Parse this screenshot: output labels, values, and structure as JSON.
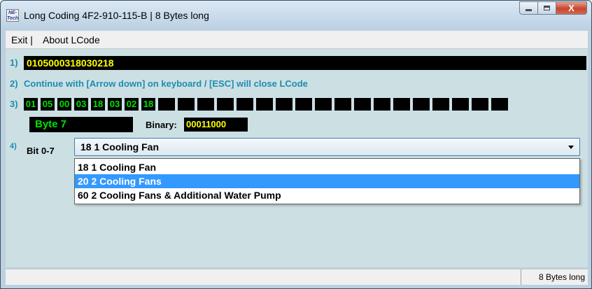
{
  "window": {
    "title": "Long Coding  4F2-910-115-B | 8 Bytes long",
    "icon_text": "NE-Tech",
    "close_glyph": "X"
  },
  "menu": {
    "items": [
      "Exit |",
      "About LCode"
    ]
  },
  "section1": {
    "label": "1)",
    "coding": "0105000318030218"
  },
  "section2": {
    "label": "2)",
    "instruction": "Continue with [Arrow down] on keyboard / [ESC] will close LCode"
  },
  "section3": {
    "label": "3)",
    "bytes": [
      "01",
      "05",
      "00",
      "03",
      "18",
      "03",
      "02",
      "18",
      "",
      "",
      "",
      "",
      "",
      "",
      "",
      "",
      "",
      "",
      "",
      "",
      "",
      "",
      "",
      "",
      "",
      ""
    ],
    "selected_byte_label": "Byte 7",
    "binary_label": "Binary:",
    "binary_value": "00011000"
  },
  "section4": {
    "label": "4)",
    "bit_label": "Bit 0-7",
    "combo_value": "18 1 Cooling Fan",
    "options": [
      "18 1 Cooling Fan",
      "20 2 Cooling Fans",
      "60 2 Cooling Fans & Additional Water Pump"
    ],
    "highlighted_index": 1
  },
  "statusbar": {
    "text": "8 Bytes long"
  },
  "colors": {
    "client_bg": "#cce0e4",
    "label_blue": "#1e8cb0",
    "byte_green": "#00e000",
    "code_yellow": "#ffff00",
    "selection_blue": "#3399ff"
  }
}
